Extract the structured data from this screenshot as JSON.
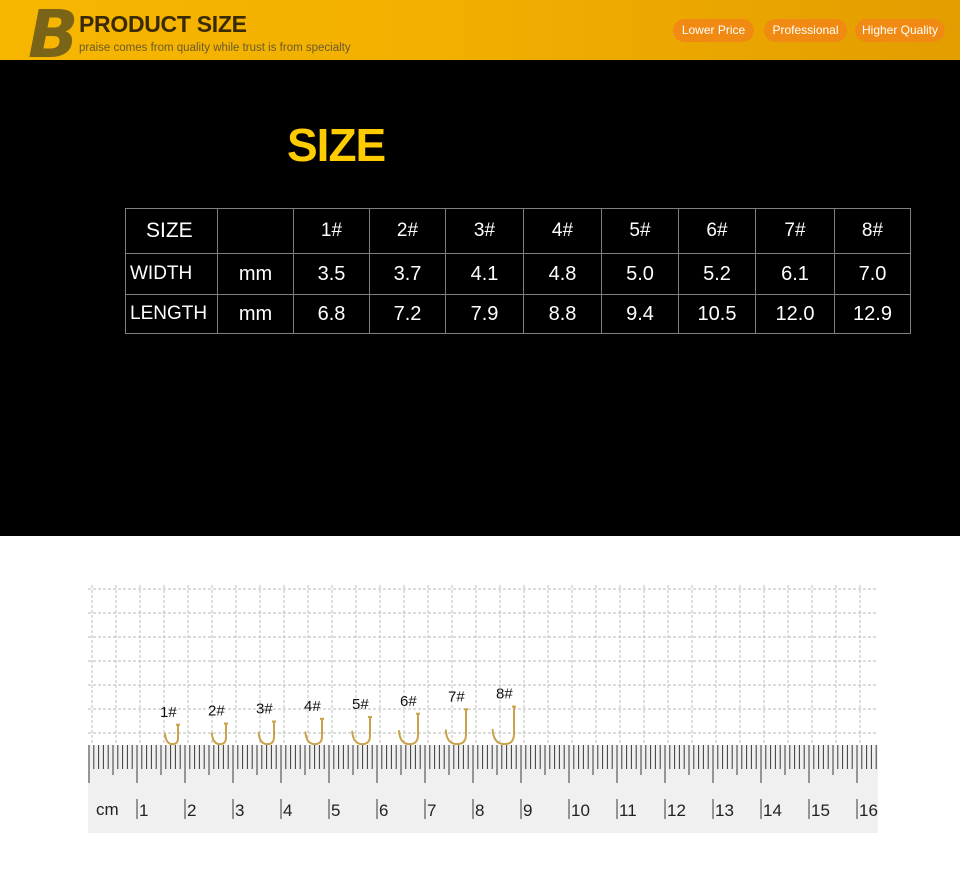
{
  "banner": {
    "logo_letter": "B",
    "title": "PRODUCT SIZE",
    "subtitle": "praise comes from quality while trust is from specialty",
    "badges": [
      "Lower Price",
      "Professional",
      "Higher Quality"
    ]
  },
  "size_section": {
    "heading": "SIZE",
    "table": {
      "header": [
        "SIZE",
        "",
        "1#",
        "2#",
        "3#",
        "4#",
        "5#",
        "6#",
        "7#",
        "8#"
      ],
      "rows": [
        [
          "WIDTH",
          "mm",
          "3.5",
          "3.7",
          "4.1",
          "4.8",
          "5.0",
          "5.2",
          "6.1",
          "7.0"
        ],
        [
          "LENGTH",
          "mm",
          "6.8",
          "7.2",
          "7.9",
          "8.8",
          "9.4",
          "10.5",
          "12.0",
          "12.9"
        ]
      ]
    }
  },
  "ruler_photo": {
    "hook_labels": [
      "1#",
      "2#",
      "3#",
      "4#",
      "5#",
      "6#",
      "7#",
      "8#"
    ],
    "hook_lengths_mm": [
      6.8,
      7.2,
      7.9,
      8.8,
      9.4,
      10.5,
      12.0,
      12.9
    ],
    "unit": "cm",
    "ruler_numbers": [
      "1",
      "2",
      "3",
      "4",
      "5",
      "6",
      "7",
      "8",
      "9",
      "10",
      "11",
      "12",
      "13",
      "14",
      "15",
      "16"
    ]
  },
  "colors": {
    "banner": "#f3b000",
    "badge": "#f08a12",
    "heading": "#ffcc00",
    "hook": "#c9a24a"
  }
}
